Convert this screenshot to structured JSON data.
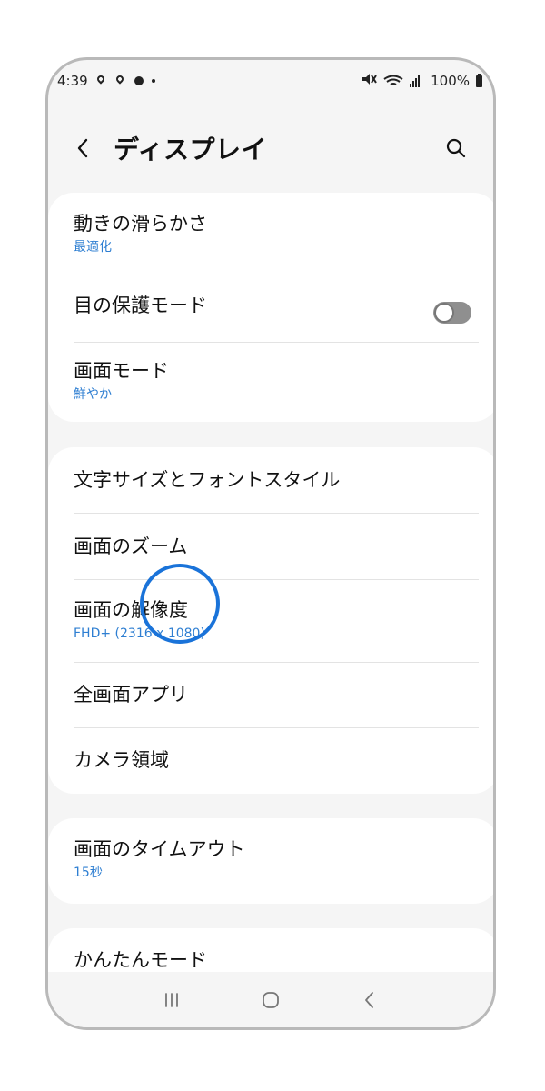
{
  "status": {
    "time": "4:39",
    "battery": "100%"
  },
  "header": {
    "title": "ディスプレイ"
  },
  "sections": [
    {
      "items": [
        {
          "title": "動きの滑らかさ",
          "subtitle": "最適化"
        },
        {
          "title": "目の保護モード",
          "toggle": false
        },
        {
          "title": "画面モード",
          "subtitle": "鮮やか"
        }
      ]
    },
    {
      "items": [
        {
          "title": "文字サイズとフォントスタイル"
        },
        {
          "title": "画面のズーム"
        },
        {
          "title": "画面の解像度",
          "subtitle": "FHD+ (2316 x 1080)"
        },
        {
          "title": "全画面アプリ"
        },
        {
          "title": "カメラ領域"
        }
      ]
    },
    {
      "items": [
        {
          "title": "画面のタイムアウト",
          "subtitle": "15秒"
        }
      ]
    },
    {
      "items": [
        {
          "title": "かんたんモード"
        }
      ]
    }
  ],
  "colors": {
    "accent": "#2f7fd2",
    "tap_circle": "#1a73d9"
  },
  "icons": {
    "back": "back-icon",
    "search": "search-icon",
    "recent": "recent-apps-icon",
    "home": "home-icon",
    "nav_back": "back-nav-icon"
  }
}
